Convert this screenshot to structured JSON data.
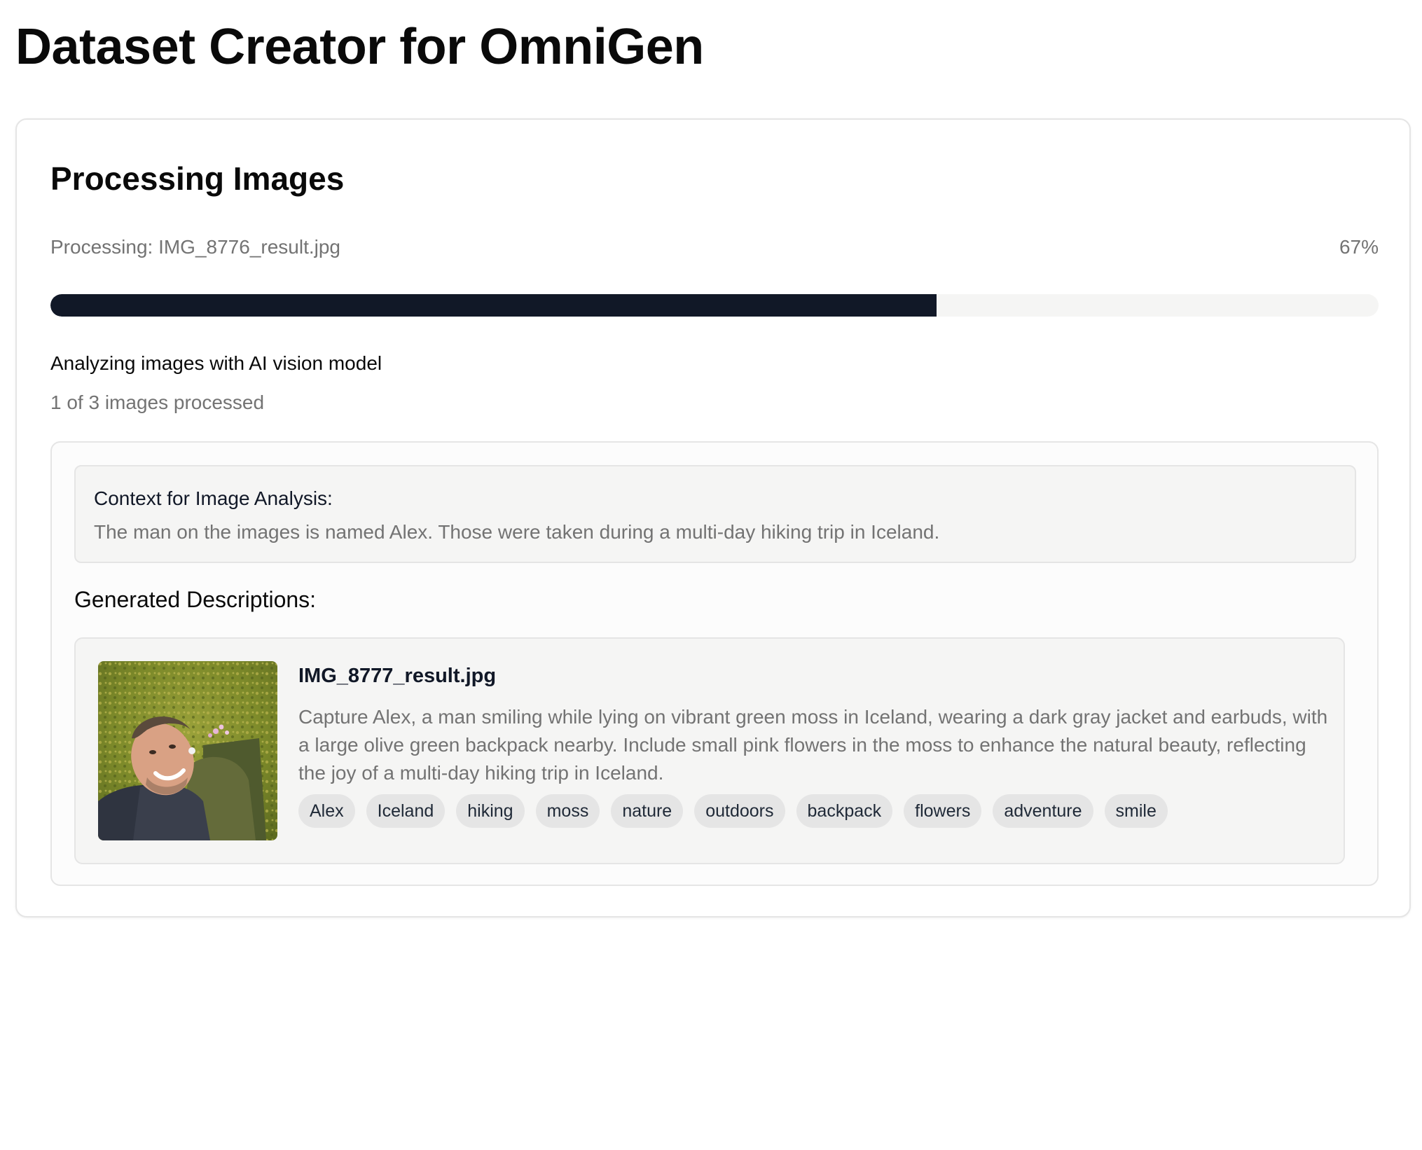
{
  "header": {
    "title": "Dataset Creator for OmniGen"
  },
  "processing": {
    "title": "Processing Images",
    "current_file": "Processing: IMG_8776_result.jpg",
    "percent_label": "67%",
    "progress": 0.667,
    "stage": "Analyzing images with AI vision model",
    "count": "1 of 3 images processed"
  },
  "context": {
    "heading": "Context for Image Analysis:",
    "text": "The man on the images is named Alex. Those were taken during a multi-day hiking trip in Iceland."
  },
  "descriptions": {
    "heading": "Generated Descriptions:",
    "items": [
      {
        "filename": "IMG_8777_result.jpg",
        "description": "Capture Alex, a man smiling while lying on vibrant green moss in Iceland, wearing a dark gray jacket and earbuds, with a large olive green backpack nearby. Include small pink flowers in the moss to enhance the natural beauty, reflecting the joy of a multi-day hiking trip in Iceland.",
        "tags": [
          "Alex",
          "Iceland",
          "hiking",
          "moss",
          "nature",
          "outdoors",
          "backpack",
          "flowers",
          "adventure",
          "smile"
        ]
      }
    ]
  },
  "colors": {
    "progress_fill": "#111827",
    "progress_track": "#f5f5f4",
    "muted_text": "#737373",
    "tag_background": "#e5e5e5"
  }
}
